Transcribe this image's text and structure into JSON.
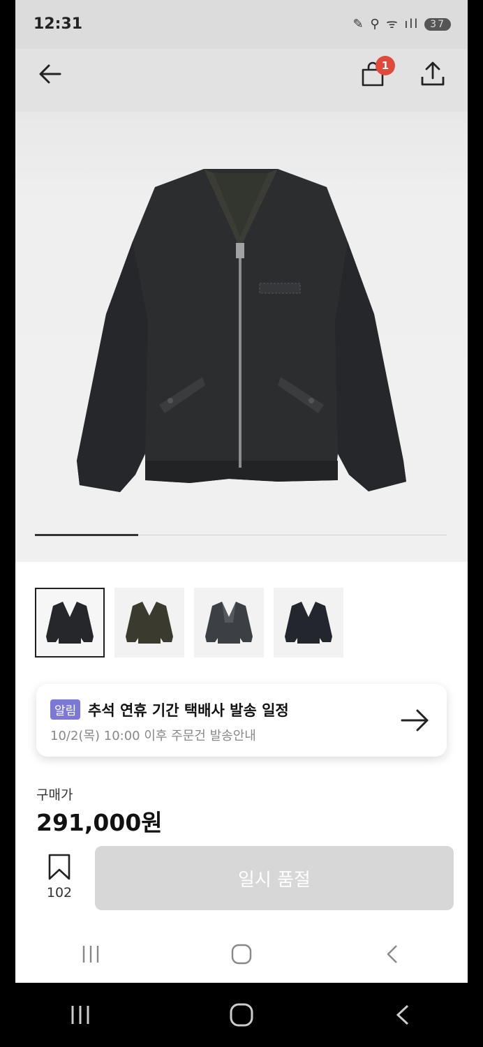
{
  "status_bar": {
    "time": "12:31",
    "icons": "✎ ⚲ ᯤ ıll",
    "battery": "37"
  },
  "header": {
    "cart_badge": "1"
  },
  "gallery": {
    "progress": 0.25
  },
  "notice": {
    "tag": "알림",
    "title": "추석 연휴 기간 택배사 발송 일정",
    "subtitle": "10/2(목) 10:00 이후 주문건 발송안내"
  },
  "price": {
    "label": "구매가",
    "value": "291,000원"
  },
  "wishlist": {
    "count": "102"
  },
  "buy_button": {
    "label": "일시 품절"
  },
  "colors": {
    "accent_badge": "#e04a3a",
    "notice_tag": "#7b78d8",
    "soldout": "#d7d7d7"
  }
}
